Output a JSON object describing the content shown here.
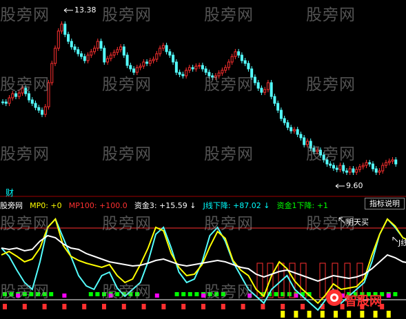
{
  "watermark": "股旁网",
  "price_chart": {
    "high_label": "13.38",
    "low_label": "9.60",
    "corner_label": "财"
  },
  "indicator": {
    "name": "股旁网",
    "items": [
      {
        "label": "MP0: +0",
        "color": "#ffff00"
      },
      {
        "label": "MP100: +100.0",
        "color": "#ff3030"
      },
      {
        "label": "资金3: +15.59 ↓",
        "color": "#ffffff"
      },
      {
        "label": "J线下降: +87.02 ↓",
        "color": "#00ffff"
      },
      {
        "label": "资金1下降: +1",
        "color": "#00ff00"
      }
    ],
    "button_label": "指标说明",
    "annotations": {
      "buy": "明天买",
      "j": "J线"
    }
  },
  "logo_text": "智股网",
  "colors": {
    "up": "#ff3030",
    "down": "#54ffff",
    "yellow": "#ffff00",
    "green": "#00ff00",
    "magenta": "#ff00ff"
  }
}
